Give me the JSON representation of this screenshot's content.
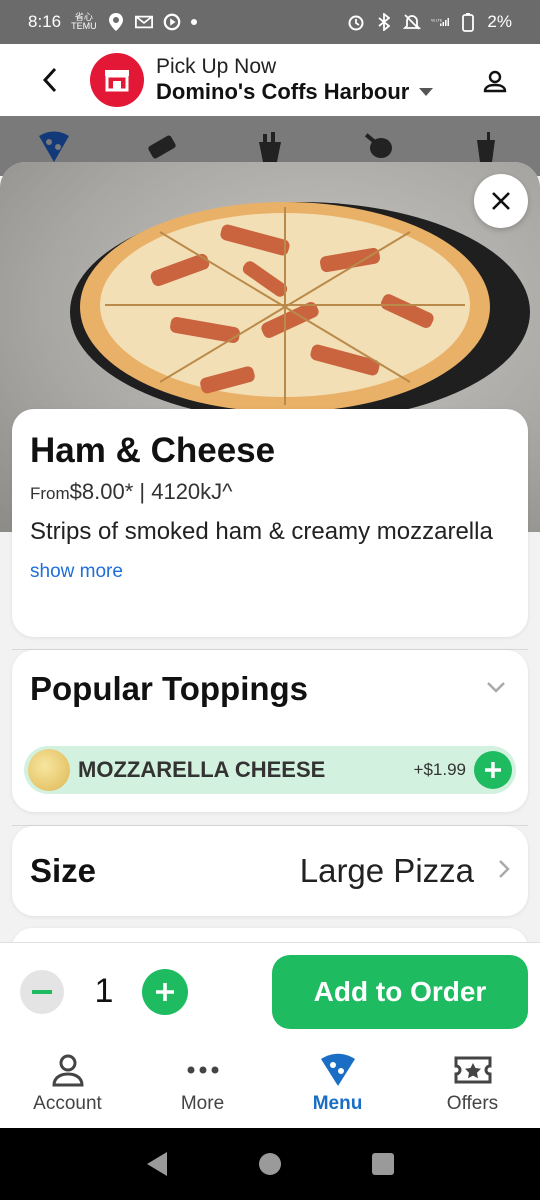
{
  "status_bar": {
    "time": "8:16",
    "temu_label": "TEMU",
    "battery_percent": "2%"
  },
  "header": {
    "pickup_label": "Pick Up Now",
    "store_name": "Domino's Coffs Harbour"
  },
  "product": {
    "title": "Ham & Cheese",
    "price_prefix": "From",
    "price_text": "$8.00* | 4120kJ^",
    "description": "Strips of smoked ham & creamy mozzarella",
    "show_more": "show more"
  },
  "toppings": {
    "title": "Popular Toppings",
    "items": [
      {
        "name": "MOZZARELLA CHEESE",
        "price": "+$1.99"
      }
    ]
  },
  "size": {
    "label": "Size",
    "value": "Large Pizza"
  },
  "order": {
    "quantity": "1",
    "add_label": "Add to Order"
  },
  "bottom_nav": {
    "items": [
      {
        "label": "Account"
      },
      {
        "label": "More"
      },
      {
        "label": "Menu"
      },
      {
        "label": "Offers"
      }
    ],
    "active": "Menu"
  },
  "colors": {
    "brand_red": "#e31837",
    "accent_green": "#1fbb61",
    "link_blue": "#1e6fd9",
    "nav_active_blue": "#1a6fc4"
  }
}
